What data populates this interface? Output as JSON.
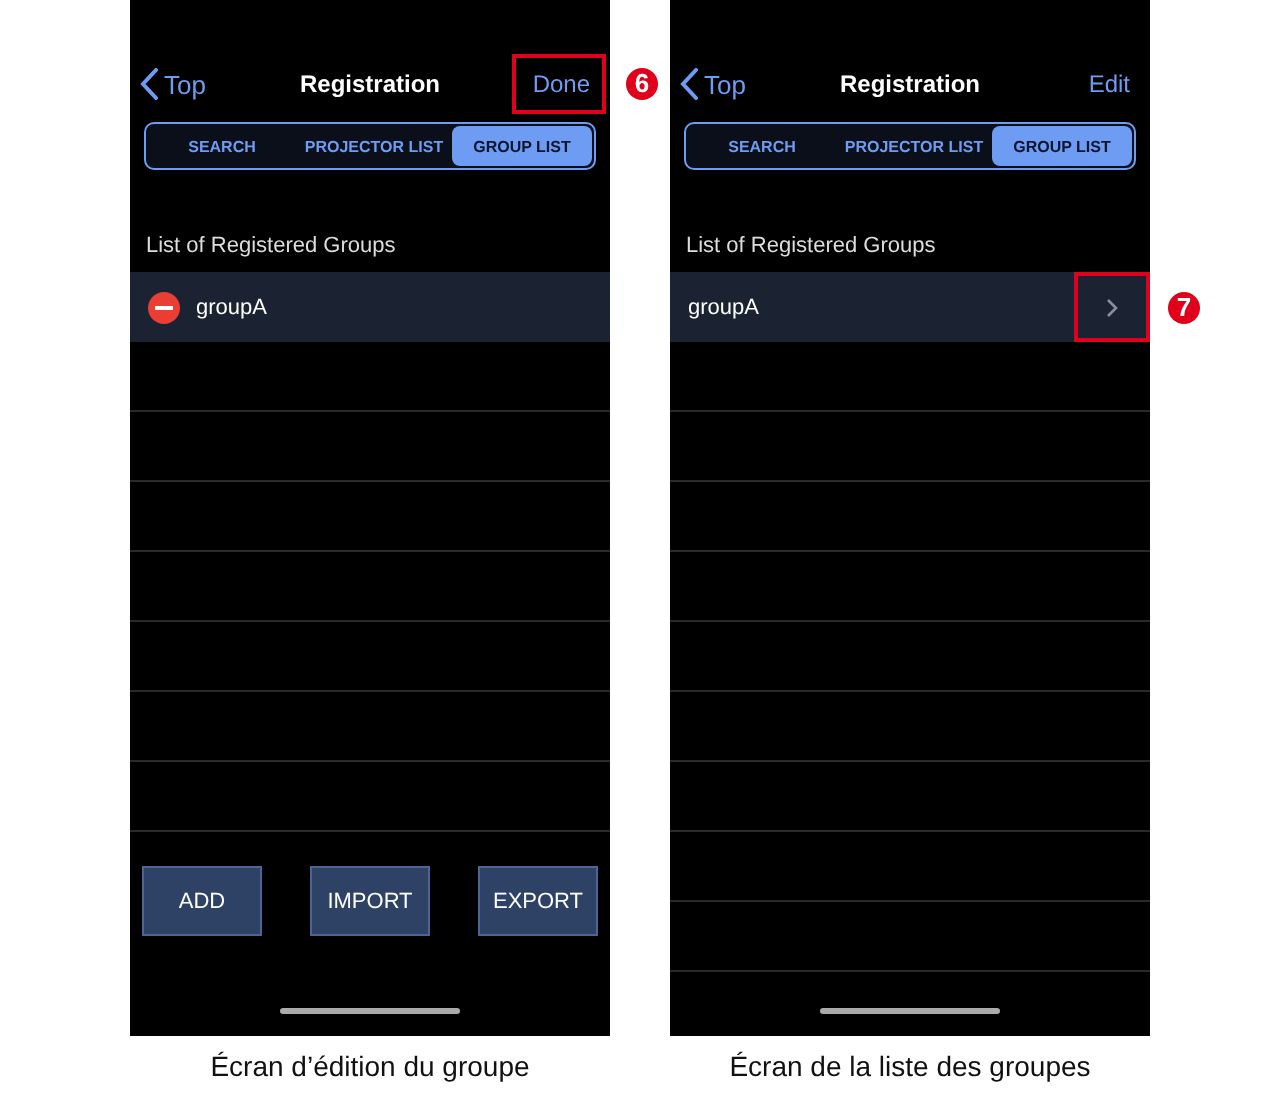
{
  "screens": [
    {
      "nav": {
        "back": "Top",
        "title": "Registration",
        "action": "Done",
        "highlighted": true
      },
      "segments": [
        {
          "label": "SEARCH",
          "selected": false
        },
        {
          "label": "PROJECTOR LIST",
          "selected": false
        },
        {
          "label": "GROUP LIST",
          "selected": true
        }
      ],
      "section_header": "List of Registered Groups",
      "editing": true,
      "groups": [
        {
          "name": "groupA"
        }
      ],
      "buttons": [
        "ADD",
        "IMPORT",
        "EXPORT"
      ],
      "callout": {
        "number": "6"
      },
      "caption": "Écran d’édition du groupe"
    },
    {
      "nav": {
        "back": "Top",
        "title": "Registration",
        "action": "Edit",
        "highlighted": false
      },
      "segments": [
        {
          "label": "SEARCH",
          "selected": false
        },
        {
          "label": "PROJECTOR LIST",
          "selected": false
        },
        {
          "label": "GROUP LIST",
          "selected": true
        }
      ],
      "section_header": "List of Registered Groups",
      "editing": false,
      "groups": [
        {
          "name": "groupA",
          "highlighted": true
        }
      ],
      "callout": {
        "number": "7"
      },
      "caption": "Écran de la liste des groupes"
    }
  ]
}
